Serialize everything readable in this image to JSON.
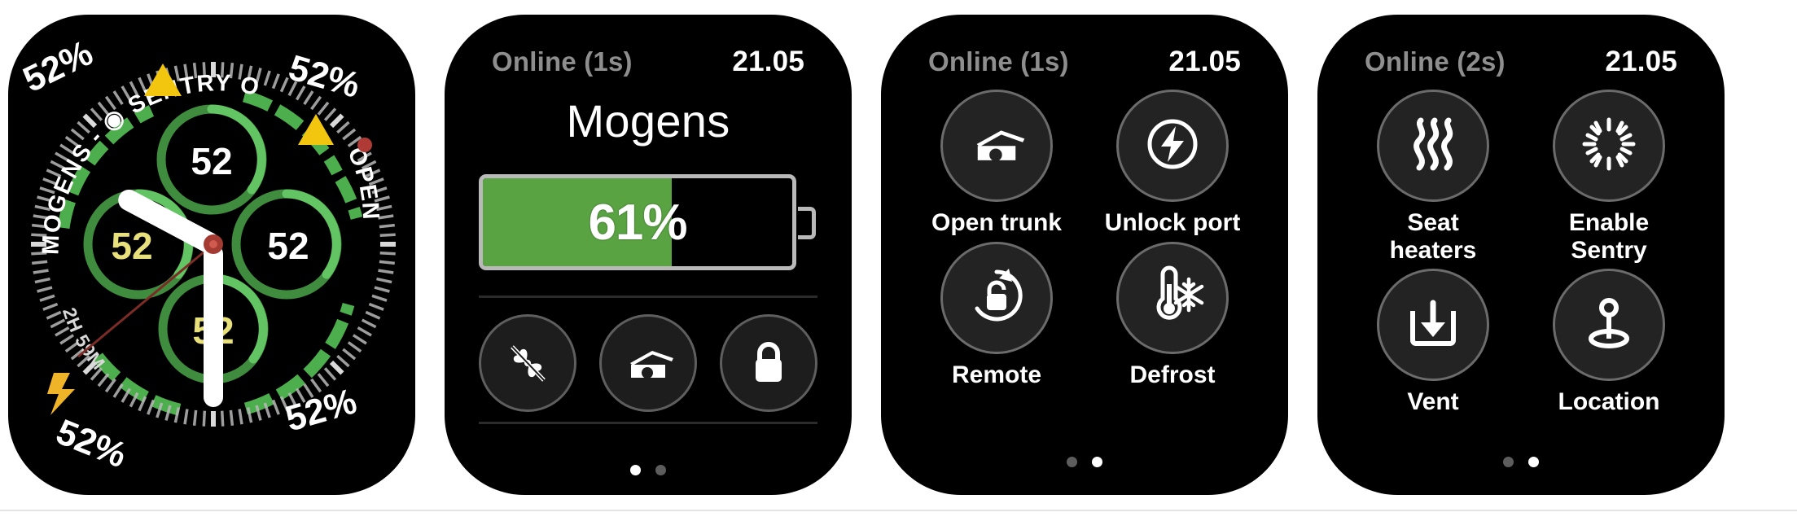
{
  "theme": {
    "screen_bg": "#000000",
    "accent_green": "#5aa343",
    "ring_green": "#4cae4c",
    "warn_yellow": "#f2c60f",
    "alert_red": "#b03a35",
    "muted_text": "#8e8e8e",
    "white": "#ffffff"
  },
  "watches": [
    {
      "id": "watch-face",
      "kind": "analog-watch-face",
      "complication_text": "MOGENS - ◉ SENTRY ON -",
      "open_text": "OPEN",
      "range_text": "2H 59M",
      "corner_percents": [
        "52%",
        "52%",
        "52%",
        "52%"
      ],
      "subdials": [
        {
          "name": "top",
          "value": "52",
          "color": "#ffffff"
        },
        {
          "name": "left",
          "value": "52",
          "color": "#e8e07a"
        },
        {
          "name": "right",
          "value": "52",
          "color": "#ffffff"
        },
        {
          "name": "bottom",
          "value": "52",
          "color": "#e8e07a"
        }
      ],
      "icons": [
        "warning-triangle",
        "warning-triangle",
        "lightning-bolt",
        "red-dot"
      ]
    },
    {
      "id": "watch-battery",
      "kind": "battery-screen",
      "status": "Online (1s)",
      "time": "21.05",
      "car_name": "Mogens",
      "battery_percent_label": "61%",
      "battery_percent_value": 61,
      "buttons": [
        {
          "name": "climate-off-button",
          "icon": "fan-slash-icon"
        },
        {
          "name": "open-trunk-button",
          "icon": "trunk-open-icon"
        },
        {
          "name": "lock-button",
          "icon": "lock-icon"
        }
      ],
      "page_dots": {
        "count": 2,
        "active": 0
      }
    },
    {
      "id": "watch-controls-1",
      "kind": "control-grid",
      "status": "Online (1s)",
      "time": "21.05",
      "buttons": [
        {
          "name": "open-trunk-button",
          "label": "Open trunk",
          "icon": "trunk-open-icon"
        },
        {
          "name": "unlock-port-button",
          "label": "Unlock port",
          "icon": "charge-port-icon"
        },
        {
          "name": "remote-button",
          "label": "Remote",
          "icon": "remote-unlock-icon"
        },
        {
          "name": "defrost-button",
          "label": "Defrost",
          "icon": "defrost-icon"
        }
      ],
      "page_dots": {
        "count": 2,
        "active": 1
      }
    },
    {
      "id": "watch-controls-2",
      "kind": "control-grid",
      "status": "Online (2s)",
      "time": "21.05",
      "buttons": [
        {
          "name": "seat-heaters-button",
          "label": "Seat heaters",
          "icon": "seat-heat-icon"
        },
        {
          "name": "enable-sentry-button",
          "label": "Enable Sentry",
          "icon": "sentry-icon"
        },
        {
          "name": "vent-button",
          "label": "Vent",
          "icon": "vent-icon"
        },
        {
          "name": "location-button",
          "label": "Location",
          "icon": "location-pin-icon"
        }
      ],
      "page_dots": {
        "count": 2,
        "active": 1
      }
    }
  ]
}
